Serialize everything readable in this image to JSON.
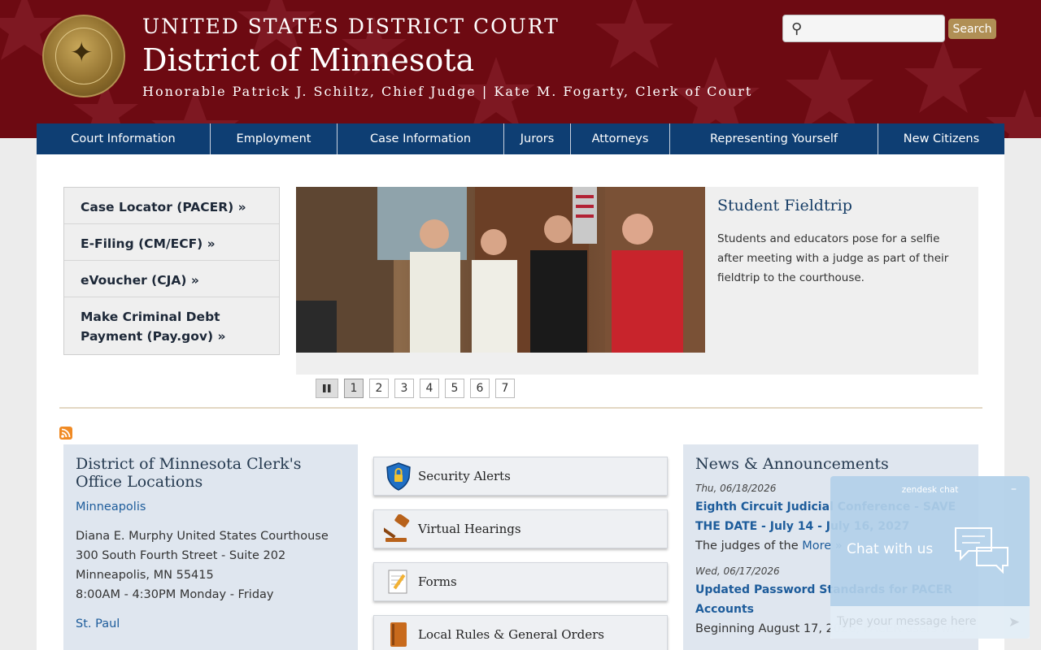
{
  "header": {
    "court_line": "UNITED STATES DISTRICT COURT",
    "district": "District of Minnesota",
    "officials": "Honorable Patrick J. Schiltz, Chief Judge | Kate M. Fogarty, Clerk of Court",
    "search_placeholder": "",
    "search_button": "Search",
    "seal_icon": "court-seal"
  },
  "nav": {
    "items": [
      {
        "label": "Court Information"
      },
      {
        "label": "Employment"
      },
      {
        "label": "Case Information"
      },
      {
        "label": "Jurors"
      },
      {
        "label": "Attorneys"
      },
      {
        "label": "Representing Yourself"
      },
      {
        "label": "New Citizens"
      }
    ]
  },
  "quick_links": [
    {
      "label": "Case Locator (PACER) »"
    },
    {
      "label": "E-Filing (CM/ECF) »"
    },
    {
      "label": "eVoucher (CJA) »"
    },
    {
      "label": "Make Criminal Debt Payment (Pay.gov) »"
    }
  ],
  "slider": {
    "title": "Student Fieldtrip",
    "description": "Students and educators pose for a selfie after meeting with a judge as part of their fieldtrip to the courthouse.",
    "pages": [
      "1",
      "2",
      "3",
      "4",
      "5",
      "6",
      "7"
    ],
    "active_page": "1",
    "pause_icon": "pause-icon"
  },
  "locations": {
    "title": "District of Minnesota Clerk's Office Locations",
    "city1": "Minneapolis",
    "addr1_line1": "Diana E. Murphy United States Courthouse",
    "addr1_line2": "300 South Fourth Street - Suite 202",
    "addr1_line3": "Minneapolis, MN 55415",
    "addr1_hours": "8:00AM - 4:30PM Monday - Friday",
    "city2": "St. Paul"
  },
  "buttons": [
    {
      "label": "Security Alerts",
      "icon": "shield-lock-icon"
    },
    {
      "label": "Virtual Hearings",
      "icon": "gavel-icon"
    },
    {
      "label": "Forms",
      "icon": "form-pencil-icon"
    },
    {
      "label": "Local Rules & General Orders",
      "icon": "book-icon"
    }
  ],
  "news": {
    "title": "News & Announcements",
    "items": [
      {
        "date": "Thu, 06/18/2026",
        "headline": "Eighth Circuit Judicial Conference - SAVE THE DATE - July 14 - July 16, 2027",
        "body": "The judges of the",
        "more": "More »"
      },
      {
        "date": "Wed, 06/17/2026",
        "headline": "Updated Password Standards for PACER Accounts",
        "body": "Beginning August 17, 2026, PACER users who"
      }
    ]
  },
  "chat": {
    "title": "zendesk chat",
    "minimize": "–",
    "call_to_action": "Chat with us",
    "input_placeholder": "Type your message here",
    "send_icon": "send-icon"
  },
  "colors": {
    "header_bg": "#6d0a12",
    "nav_bg": "#0e3e73",
    "link": "#1d5c9b",
    "search_btn": "#b08f55"
  }
}
